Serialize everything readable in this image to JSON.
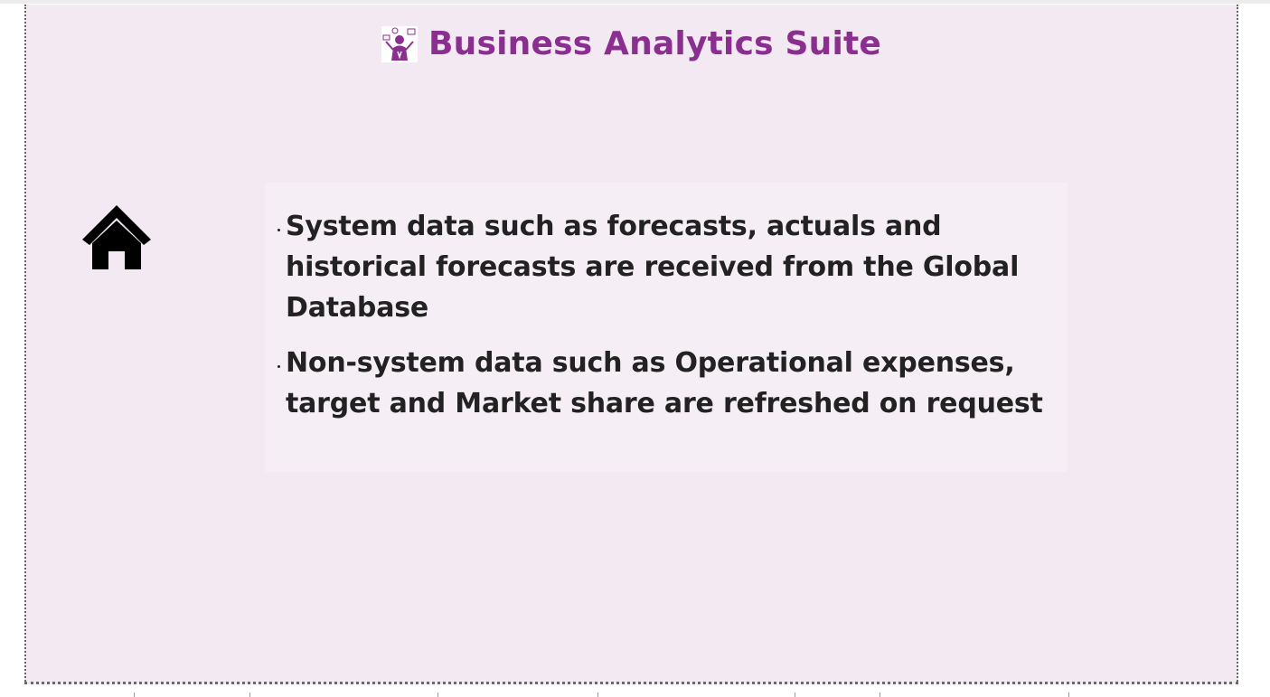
{
  "header": {
    "title": "Business Analytics Suite",
    "logo_icon": "analytics-person-icon",
    "accent_color": "#8a2f8f"
  },
  "navigation": {
    "home_icon": "home-icon"
  },
  "content": {
    "bullets": [
      {
        "text": "System data such as forecasts, actuals and historical forecasts are received from the Global Database"
      },
      {
        "text": "Non-system data such as Operational expenses, target and Market share are refreshed on request"
      }
    ]
  },
  "colors": {
    "canvas_background": "#f2e9f2",
    "panel_background": "#f5eff5",
    "text": "#222222"
  }
}
